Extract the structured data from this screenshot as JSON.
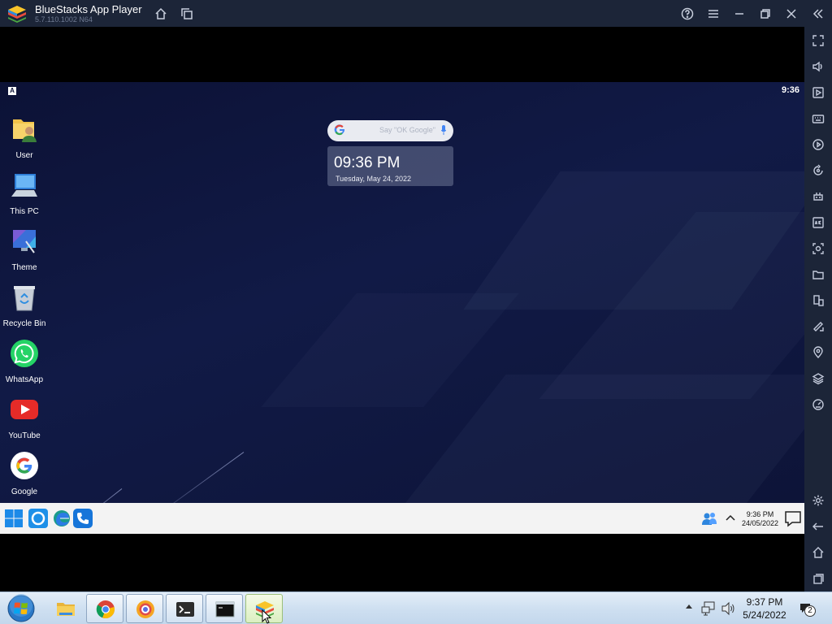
{
  "window": {
    "title": "BlueStacks App Player",
    "version": "5.7.110.1002  N64",
    "titlebar_icons": [
      "home-icon",
      "multi-instance-icon",
      "help-icon",
      "menu-icon",
      "minimize-icon",
      "restore-icon",
      "close-icon",
      "collapse-sidebar-icon"
    ]
  },
  "sidebar": {
    "items": [
      {
        "name": "fullscreen-icon"
      },
      {
        "name": "volume-icon"
      },
      {
        "name": "media-folder-icon"
      },
      {
        "name": "keyboard-controls-icon"
      },
      {
        "name": "macro-record-icon"
      },
      {
        "name": "sync-icon"
      },
      {
        "name": "game-controls-icon"
      },
      {
        "name": "install-apk-icon"
      },
      {
        "name": "screenshot-icon"
      },
      {
        "name": "folder-icon"
      },
      {
        "name": "multi-instance-manager-icon"
      },
      {
        "name": "rotate-icon"
      },
      {
        "name": "location-icon"
      },
      {
        "name": "layers-icon"
      },
      {
        "name": "performance-icon"
      },
      {
        "name": "settings-icon"
      },
      {
        "name": "back-icon"
      },
      {
        "name": "home-icon"
      },
      {
        "name": "recent-apps-icon"
      }
    ]
  },
  "android": {
    "status_badge": "A",
    "status_time": "9:36",
    "desktop_icons": [
      {
        "label": "User"
      },
      {
        "label": "This PC"
      },
      {
        "label": "Theme"
      },
      {
        "label": "Recycle Bin"
      },
      {
        "label": "WhatsApp"
      },
      {
        "label": "YouTube"
      },
      {
        "label": "Google"
      }
    ],
    "search": {
      "placeholder": "Say \"OK Google\""
    },
    "clock_widget": {
      "time": "09:36 PM",
      "date": "Tuesday, May 24, 2022"
    },
    "taskbar": {
      "apps": [
        "windows-start-icon",
        "cortana-icon",
        "edge-icon",
        "phone-icon"
      ],
      "tray_time": "9:36 PM",
      "tray_date": "24/05/2022"
    }
  },
  "windows_taskbar": {
    "pinned": [
      "file-explorer",
      "chrome",
      "browser",
      "terminal",
      "command-prompt",
      "bluestacks"
    ],
    "time": "9:37 PM",
    "date": "5/24/2022",
    "notification_count": "2"
  }
}
